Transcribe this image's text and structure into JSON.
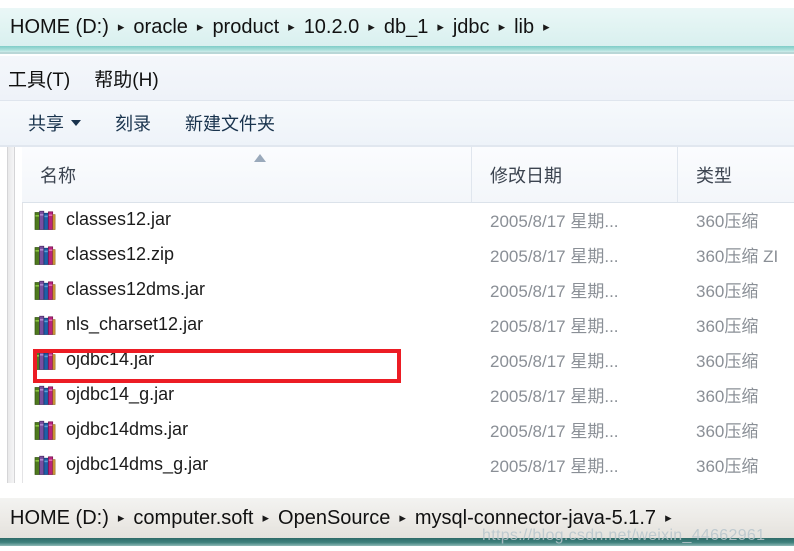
{
  "top_window": {
    "address_bar": {
      "name": "address-bar",
      "crumbs": [
        "HOME (D:)",
        "oracle",
        "product",
        "10.2.0",
        "db_1",
        "jdbc",
        "lib"
      ],
      "separator": "▸"
    },
    "menu_bar": {
      "items": [
        {
          "label": "工具(T)",
          "name": "menu-tools"
        },
        {
          "label": "帮助(H)",
          "name": "menu-help"
        }
      ]
    },
    "toolbar": {
      "items": [
        {
          "label": "共享",
          "name": "toolbar-share",
          "has_caret": true
        },
        {
          "label": "刻录",
          "name": "toolbar-burn",
          "has_caret": false
        },
        {
          "label": "新建文件夹",
          "name": "toolbar-new-folder",
          "has_caret": false
        }
      ]
    },
    "file_list": {
      "columns": [
        {
          "label": "名称",
          "name": "column-name",
          "sorted": true
        },
        {
          "label": "修改日期",
          "name": "column-date-modified",
          "sorted": false
        },
        {
          "label": "类型",
          "name": "column-type",
          "sorted": false
        }
      ],
      "rows": [
        {
          "name": "classes12.jar",
          "date": "2005/8/17 星期...",
          "type": "360压缩",
          "highlighted": false
        },
        {
          "name": "classes12.zip",
          "date": "2005/8/17 星期...",
          "type": "360压缩 ZI",
          "highlighted": false
        },
        {
          "name": "classes12dms.jar",
          "date": "2005/8/17 星期...",
          "type": "360压缩",
          "highlighted": false
        },
        {
          "name": "nls_charset12.jar",
          "date": "2005/8/17 星期...",
          "type": "360压缩",
          "highlighted": false
        },
        {
          "name": "ojdbc14.jar",
          "date": "2005/8/17 星期...",
          "type": "360压缩",
          "highlighted": true
        },
        {
          "name": "ojdbc14_g.jar",
          "date": "2005/8/17 星期...",
          "type": "360压缩",
          "highlighted": false
        },
        {
          "name": "ojdbc14dms.jar",
          "date": "2005/8/17 星期...",
          "type": "360压缩",
          "highlighted": false
        },
        {
          "name": "ojdbc14dms_g.jar",
          "date": "2005/8/17 星期...",
          "type": "360压缩",
          "highlighted": false
        }
      ],
      "file_icon": "archive-zip-icon"
    }
  },
  "bottom_window": {
    "address_bar": {
      "name": "address-bar-secondary",
      "crumbs": [
        "HOME (D:)",
        "computer.soft",
        "OpenSource",
        "mysql-connector-java-5.1.7"
      ],
      "separator": "▸"
    }
  },
  "watermark": {
    "text": "https://blog.csdn.net/weixin_44662961"
  },
  "colors": {
    "highlight_red": "#ec1c24",
    "address_bar_top": "#e3f4f3",
    "address_band_teal": "#7fcdc8",
    "bottom_band_teal": "#2f6b68",
    "text_primary": "#1b1b1b",
    "text_muted": "#8a8f96"
  }
}
